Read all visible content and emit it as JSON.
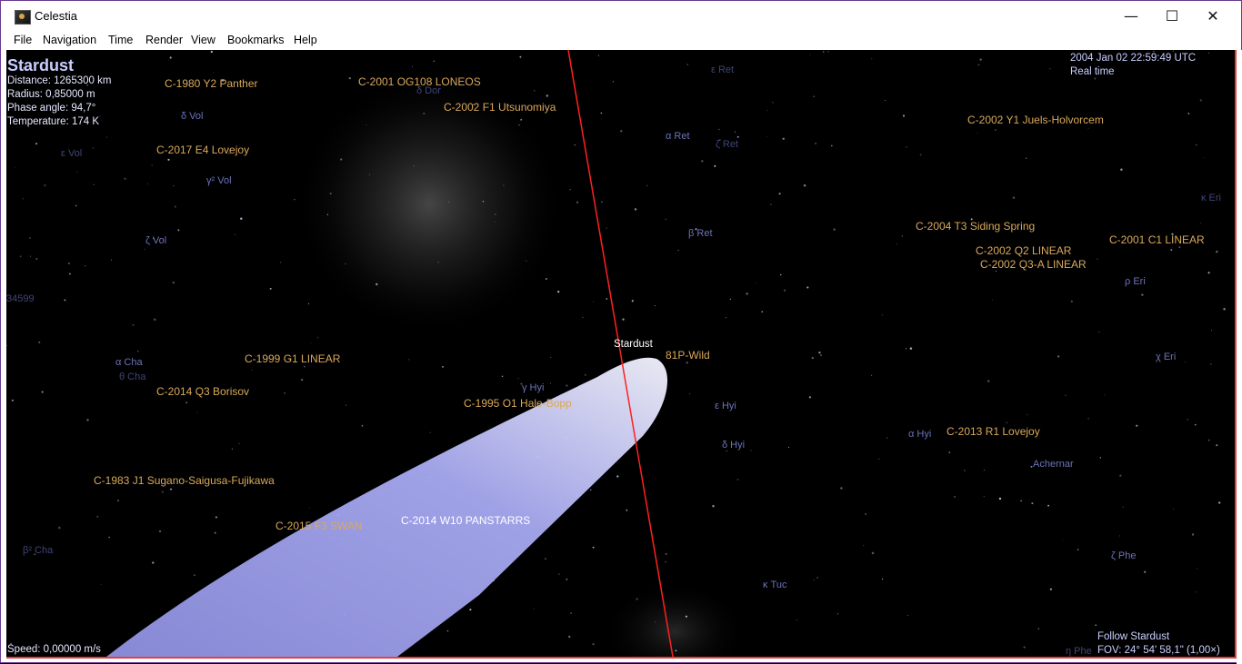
{
  "window": {
    "title": "Celestia"
  },
  "controls": {
    "minimize": "—",
    "maximize": "☐",
    "close": "✕"
  },
  "menu": [
    "File",
    "Navigation",
    "Time",
    "Render",
    "View",
    "Bookmarks",
    "Help"
  ],
  "hud": {
    "object": "Stardust",
    "distance": "Distance: 1265300 km",
    "radius": "Radius: 0,85000 m",
    "phase": "Phase angle: 94,7°",
    "temperature": "Temperature: 174 K",
    "datetime": "2004 Jan 02 22:59:49 UTC",
    "timemode": "Real time",
    "speed": "Speed: 0,00000 m/s",
    "follow": "Follow Stardust",
    "fov": "FOV: 24° 54' 58,1\" (1,00×)"
  },
  "comet_labels": {
    "c1980": "C-1980 Y2 Panther",
    "c2001og": "C-2001 OG108 LONEOS",
    "c2002f1": "C-2002 F1 Utsunomiya",
    "c2017e4": "C-2017 E4 Lovejoy",
    "c2002y1": "C-2002 Y1 Juels-Holvorcem",
    "c2004t3": "C-2004 T3 Siding Spring",
    "c2002q2": "C-2002 Q2 LINEAR",
    "c2002q3": "C-2002 Q3-A LINEAR",
    "c2001c1": "C-2001 C1 LINEAR",
    "c1999g1": "C-1999 G1 LINEAR",
    "c2014q3": "C-2014 Q3 Borisov",
    "c1995o1": "C-1995 O1 Hale-Bopp",
    "c2013r1": "C-2013 R1 Lovejoy",
    "c1983j1": "C-1983 J1 Sugano-Saigusa-Fujikawa",
    "c2015f3": "C-2015 F3 SWAN",
    "c2014w10": "C-2014 W10 PANSTARRS",
    "wild": "81P-Wild",
    "stardust": "Stardust"
  },
  "star_labels": {
    "delta_vol": "δ Vol",
    "eps_vol": "ε Vol",
    "gamma2_vol": "γ² Vol",
    "zeta_vol": "ζ Vol",
    "alpha_ret": "α Ret",
    "beta_ret": "β Ret",
    "eps_ret": "ε Ret",
    "zeta_ret": "ζ Ret",
    "rho_eri": "ρ Eri",
    "chi_eri": "χ Eri",
    "kappa_eri": "κ Eri",
    "alpha_cha": "α Cha",
    "theta_cha": "θ Cha",
    "gamma_hyi": "γ Hyi",
    "eps_hyi": "ε Hyi",
    "delta_hyi": "δ Hyi",
    "alpha_hyi": "α Hyi",
    "achernar": "Achernar",
    "zeta_phe": "ζ Phe",
    "kappa_tuc": "κ Tuc",
    "beta_cha": "β² Cha",
    "dor": "δ Dor",
    "hip": "34599",
    "phe": "η Phe",
    "ret_sat": "ζ Ret"
  }
}
